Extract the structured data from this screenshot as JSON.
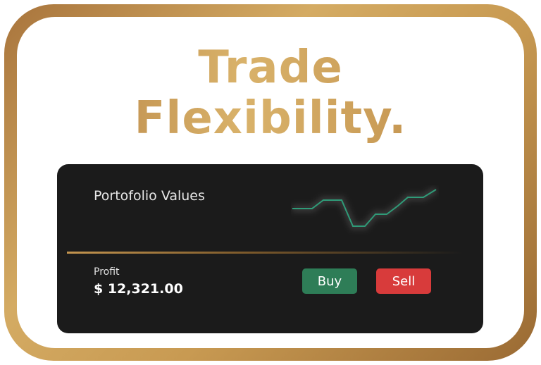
{
  "headline": {
    "line1": "Trade",
    "line2": "Flexibility."
  },
  "card": {
    "title": "Portofolio Values",
    "profit_label": "Profit",
    "profit_value": "$ 12,321.00",
    "buy_label": "Buy",
    "sell_label": "Sell"
  },
  "colors": {
    "gold": "#c99a55",
    "card_bg": "#1b1b1b",
    "buy": "#2e7d57",
    "sell": "#d83b3b",
    "sparkline": "#2f9b78"
  },
  "icons": [
    "portfolio-sparkline-icon"
  ]
}
